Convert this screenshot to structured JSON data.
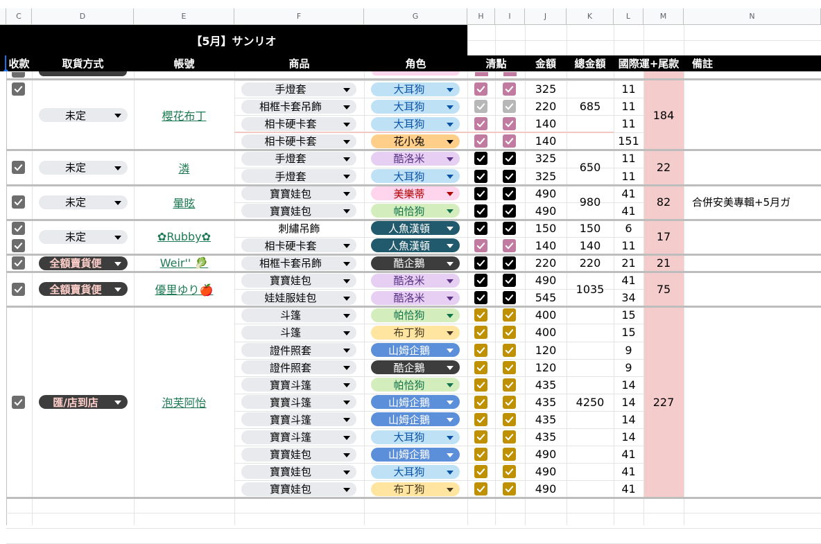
{
  "columns": [
    "C",
    "D",
    "E",
    "F",
    "G",
    "H",
    "I",
    "J",
    "K",
    "L",
    "M",
    "N"
  ],
  "banner": "【5月】サンリオ",
  "headers": {
    "c": "收款",
    "d": "取貨方式",
    "e": "帳號",
    "f": "商品",
    "g": "角色",
    "hi": "清點",
    "j": "金額",
    "k": "總金額",
    "l": "國際運+尾款",
    "n": "備註"
  },
  "colors": {
    "pink_check": "#c27ba0",
    "gray_check": "#b7b7b7",
    "black_check": "#000000",
    "gold_check": "#bf9000",
    "fee_bg": "#f4cccc",
    "link": "#1e7a54"
  },
  "roles": {
    "大耳狗": {
      "bg": "#bfe1f6",
      "fg": "#0a53a8"
    },
    "花小兔": {
      "bg": "#ffcf8a",
      "fg": "#000000"
    },
    "酷洛米": {
      "bg": "#e6cff2",
      "fg": "#5a3286"
    },
    "美樂蒂": {
      "bg": "#ffd5ee",
      "fg": "#b10202"
    },
    "帕恰狗": {
      "bg": "#d4edbc",
      "fg": "#11734b"
    },
    "人魚漢頓": {
      "bg": "#215a6c",
      "fg": "#ffffff"
    },
    "酷企鵝": {
      "bg": "#3d3d3d",
      "fg": "#ffffff"
    },
    "布丁狗": {
      "bg": "#ffe5a0",
      "fg": "#473821"
    },
    "山姆企鵝": {
      "bg": "#5b8fd9",
      "fg": "#ffffff"
    }
  },
  "rows": [
    {
      "item": "手燈套",
      "role": "大耳狗",
      "h": "pink",
      "i": "pink",
      "amount": "325",
      "fee": "11"
    },
    {
      "item": "相框卡套吊飾",
      "role": "大耳狗",
      "h": "gray",
      "i": "gray",
      "amount": "220",
      "fee": "11"
    },
    {
      "item": "相卡硬卡套",
      "role": "大耳狗",
      "h": "pink",
      "i": "pink",
      "amount": "140",
      "fee": "11"
    },
    {
      "item": "相卡硬卡套",
      "role": "花小兔",
      "h": "pink",
      "i": "pink",
      "amount": "140",
      "fee": "151"
    },
    {
      "item": "手燈套",
      "role": "酷洛米",
      "h": "black",
      "i": "black",
      "amount": "325",
      "fee": "11"
    },
    {
      "item": "手燈套",
      "role": "大耳狗",
      "h": "black",
      "i": "black",
      "amount": "325",
      "fee": "11"
    },
    {
      "item": "寶寶娃包",
      "role": "美樂蒂",
      "h": "black",
      "i": "black",
      "amount": "490",
      "fee": "41"
    },
    {
      "item": "寶寶娃包",
      "role": "帕恰狗",
      "h": "black",
      "i": "black",
      "amount": "490",
      "fee": "41"
    },
    {
      "item": "刺繡吊飾",
      "role": "人魚漢頓",
      "h": "black",
      "i": "black",
      "amount": "150",
      "fee": "6",
      "plain": true
    },
    {
      "item": "相卡硬卡套",
      "role": "人魚漢頓",
      "h": "pink",
      "i": "pink",
      "amount": "140",
      "fee": "11"
    },
    {
      "item": "相框卡套吊飾",
      "role": "酷企鵝",
      "h": "black",
      "i": "black",
      "amount": "220",
      "fee": "21"
    },
    {
      "item": "寶寶娃包",
      "role": "酷洛米",
      "h": "black",
      "i": "black",
      "amount": "490",
      "fee": "41"
    },
    {
      "item": "娃娃服娃包",
      "role": "酷洛米",
      "h": "black",
      "i": "black",
      "amount": "545",
      "fee": "34"
    },
    {
      "item": "斗篷",
      "role": "帕恰狗",
      "h": "gold",
      "i": "gold",
      "amount": "400",
      "fee": "15"
    },
    {
      "item": "斗篷",
      "role": "布丁狗",
      "h": "gold",
      "i": "gold",
      "amount": "400",
      "fee": "15"
    },
    {
      "item": "證件照套",
      "role": "山姆企鵝",
      "h": "gold",
      "i": "gold",
      "amount": "120",
      "fee": "9"
    },
    {
      "item": "證件照套",
      "role": "酷企鵝",
      "h": "gold",
      "i": "gold",
      "amount": "120",
      "fee": "9"
    },
    {
      "item": "寶寶斗篷",
      "role": "帕恰狗",
      "h": "gold",
      "i": "gold",
      "amount": "435",
      "fee": "14"
    },
    {
      "item": "寶寶斗篷",
      "role": "山姆企鵝",
      "h": "gold",
      "i": "gold",
      "amount": "435",
      "fee": "14"
    },
    {
      "item": "寶寶斗篷",
      "role": "山姆企鵝",
      "h": "gold",
      "i": "gold",
      "amount": "435",
      "fee": "14"
    },
    {
      "item": "寶寶斗篷",
      "role": "大耳狗",
      "h": "gold",
      "i": "gold",
      "amount": "435",
      "fee": "14"
    },
    {
      "item": "寶寶娃包",
      "role": "山姆企鵝",
      "h": "gold",
      "i": "gold",
      "amount": "490",
      "fee": "41"
    },
    {
      "item": "寶寶娃包",
      "role": "大耳狗",
      "h": "gold",
      "i": "gold",
      "amount": "490",
      "fee": "41"
    },
    {
      "item": "寶寶娃包",
      "role": "布丁狗",
      "h": "gold",
      "i": "gold",
      "amount": "490",
      "fee": "41"
    }
  ],
  "groups": [
    {
      "start": 0,
      "end": 3,
      "account": "櫻花布丁",
      "method": "未定",
      "method_style": "light",
      "total": "685",
      "total_end": 2,
      "fee_total": "184",
      "note": "",
      "checks": [
        0
      ],
      "mcheck": 1
    },
    {
      "start": 4,
      "end": 5,
      "account": "潾",
      "method": "未定",
      "method_style": "light",
      "total": "650",
      "fee_total": "22",
      "note": "",
      "checks": [
        4.5
      ]
    },
    {
      "start": 6,
      "end": 7,
      "account": "暈眩",
      "method": "未定",
      "method_style": "light",
      "total": "980",
      "fee_total": "82",
      "note": "合併安美專輯+5月ガ",
      "checks": [
        6.5
      ]
    },
    {
      "start": 8,
      "end": 9,
      "account": "✿Rubby✿",
      "method": "未定",
      "method_style": "light",
      "totals": [
        "150",
        "140"
      ],
      "fee_total": "17",
      "note": "",
      "checks": [
        8,
        9
      ]
    },
    {
      "start": 10,
      "end": 10,
      "account": "Weir'' 🥬",
      "method": "全額賣貨便",
      "method_style": "dark",
      "total": "220",
      "fee_total": "21",
      "note": "",
      "checks": [
        10
      ]
    },
    {
      "start": 11,
      "end": 12,
      "account": "優里ゆり🍎",
      "method": "全額賣貨便",
      "method_style": "dark",
      "total": "1035",
      "fee_total": "75",
      "note": "",
      "checks": [
        11.5
      ]
    },
    {
      "start": 13,
      "end": 23,
      "account": "泡芙阿怡",
      "method": "匯/店到店",
      "method_style": "dark",
      "total": "4250",
      "fee_total": "227",
      "note": "",
      "checks": [
        18
      ]
    }
  ]
}
